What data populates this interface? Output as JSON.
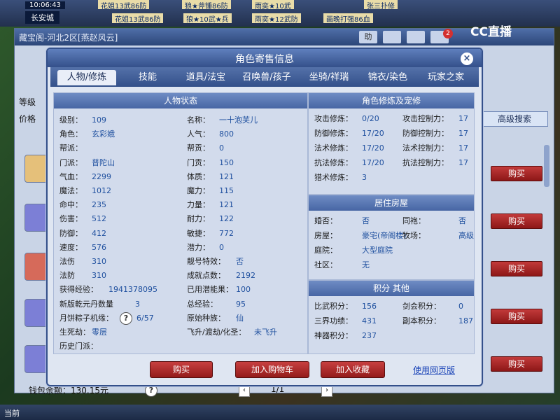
{
  "top": {
    "clock": "10:06:43",
    "city": "长安城",
    "notices_row1": [
      "花姐13武86防",
      "狼★斧锤86防",
      "雨奕★10武",
      "张三扑修"
    ],
    "notices_row2": [
      "花姐13武86防",
      "狼★10武★兵",
      "雨奕★12武防",
      "画晚打强86血"
    ]
  },
  "cc_logo": "CC直播",
  "shop": {
    "title": "藏宝阁-河北2区[燕赵风云]",
    "level_label": "等级",
    "price_label": "价格",
    "advanced_search": "高级搜索",
    "buy_label": "购买",
    "wallet": "钱包余额：130.15元",
    "page": "1/1",
    "notify_count": "2",
    "help_label": "助"
  },
  "dialog": {
    "title": "角色寄售信息",
    "close": "×",
    "tabs": [
      "人物/修炼",
      "技能",
      "道具/法宝",
      "召唤兽/孩子",
      "坐骑/祥瑞",
      "锦衣/染色",
      "玩家之家"
    ],
    "left": {
      "header": "人物状态",
      "col1": [
        {
          "k": "级别：",
          "v": "109"
        },
        {
          "k": "角色：",
          "v": "玄彩娥"
        },
        {
          "k": "帮派：",
          "v": ""
        },
        {
          "k": "门派：",
          "v": "普陀山"
        },
        {
          "k": "气血：",
          "v": "2299"
        },
        {
          "k": "魔法：",
          "v": "1012"
        },
        {
          "k": "命中：",
          "v": "235"
        },
        {
          "k": "伤害：",
          "v": "512"
        },
        {
          "k": "防御：",
          "v": "412"
        },
        {
          "k": "速度：",
          "v": "576"
        },
        {
          "k": "法伤",
          "v": "310"
        },
        {
          "k": "法防",
          "v": "310"
        },
        {
          "k": "获得经验：",
          "v": "1941378095"
        },
        {
          "k": "新版乾元丹数量",
          "v": "3"
        },
        {
          "k": "月饼粽子机缘：",
          "v": "6/57"
        },
        {
          "k": "生死劫：",
          "v": "零层"
        },
        {
          "k": "历史门派：",
          "v": ""
        }
      ],
      "col2": [
        {
          "k": "名称：",
          "v": "一十泡芙儿"
        },
        {
          "k": "人气：",
          "v": "800"
        },
        {
          "k": "帮贡：",
          "v": "0"
        },
        {
          "k": "门贡：",
          "v": "150"
        },
        {
          "k": "体质：",
          "v": "121"
        },
        {
          "k": "魔力：",
          "v": "115"
        },
        {
          "k": "力量：",
          "v": "121"
        },
        {
          "k": "耐力：",
          "v": "122"
        },
        {
          "k": "敏捷：",
          "v": "772"
        },
        {
          "k": "潜力：",
          "v": "0"
        },
        {
          "k": "靓号特效：",
          "v": "否"
        },
        {
          "k": "成就点数：",
          "v": "2192"
        },
        {
          "k": "已用潜能果：",
          "v": "100"
        },
        {
          "k": "总经验：",
          "v": "95"
        },
        {
          "k": "原始种族：",
          "v": "仙"
        },
        {
          "k": "飞升/渡劫/化圣：",
          "v": "未飞升"
        }
      ]
    },
    "right_top": {
      "header": "角色修炼及宠修",
      "rows": [
        [
          {
            "k": "攻击修炼：",
            "v": "0/20"
          },
          {
            "k": "攻击控制力：",
            "v": "17"
          }
        ],
        [
          {
            "k": "防御修炼：",
            "v": "17/20"
          },
          {
            "k": "防御控制力：",
            "v": "17"
          }
        ],
        [
          {
            "k": "法术修炼：",
            "v": "17/20"
          },
          {
            "k": "法术控制力：",
            "v": "17"
          }
        ],
        [
          {
            "k": "抗法修炼：",
            "v": "17/20"
          },
          {
            "k": "抗法控制力：",
            "v": "17"
          }
        ],
        [
          {
            "k": "猎术修炼：",
            "v": "3"
          },
          {
            "k": "",
            "v": ""
          }
        ]
      ]
    },
    "right_mid": {
      "header": "居住房屋",
      "rows": [
        [
          {
            "k": "婚否：",
            "v": "否"
          },
          {
            "k": "同袍：",
            "v": "否"
          }
        ],
        [
          {
            "k": "房屋：",
            "v": "豪宅(帝阁楼)"
          },
          {
            "k": "牧场：",
            "v": "高级"
          }
        ],
        [
          {
            "k": "庭院：",
            "v": "大型庭院"
          },
          {
            "k": "",
            "v": ""
          }
        ],
        [
          {
            "k": "社区：",
            "v": "无"
          },
          {
            "k": "",
            "v": ""
          }
        ]
      ]
    },
    "right_bot": {
      "header": "积分 其他",
      "rows": [
        [
          {
            "k": "比武积分：",
            "v": "156"
          },
          {
            "k": "剑会积分：",
            "v": "0"
          }
        ],
        [
          {
            "k": "三界功绩：",
            "v": "431"
          },
          {
            "k": "副本积分：",
            "v": "187"
          }
        ],
        [
          {
            "k": "神器积分：",
            "v": "237"
          },
          {
            "k": "",
            "v": ""
          }
        ]
      ]
    },
    "buttons": {
      "buy": "购买",
      "add_cart": "加入购物车",
      "add_fav": "加入收藏",
      "web_version": "使用网页版"
    }
  },
  "bottom": {
    "label": "当前"
  }
}
